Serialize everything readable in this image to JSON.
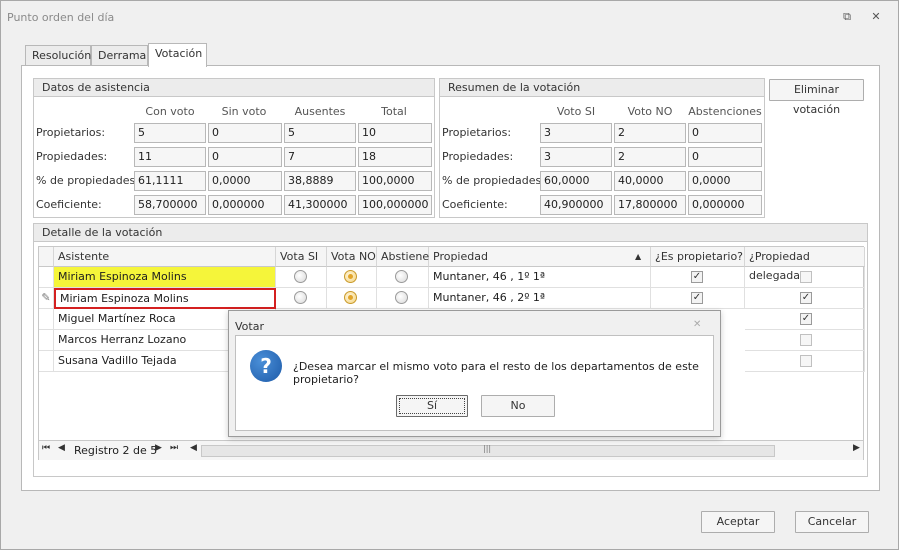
{
  "window": {
    "title": "Punto orden del día"
  },
  "tabs": [
    {
      "label": "Resolución"
    },
    {
      "label": "Derrama"
    },
    {
      "label": "Votación"
    }
  ],
  "asistencia": {
    "title": "Datos de asistencia",
    "columns": [
      "Con voto",
      "Sin voto",
      "Ausentes",
      "Total"
    ],
    "rows": [
      {
        "label": "Propietarios:",
        "values": [
          "5",
          "0",
          "5",
          "10"
        ]
      },
      {
        "label": "Propiedades:",
        "values": [
          "11",
          "0",
          "7",
          "18"
        ]
      },
      {
        "label": "% de propiedades:",
        "values": [
          "61,1111",
          "0,0000",
          "38,8889",
          "100,0000"
        ]
      },
      {
        "label": "Coeficiente:",
        "values": [
          "58,700000",
          "0,000000",
          "41,300000",
          "100,000000"
        ]
      }
    ]
  },
  "resumen": {
    "title": "Resumen de la votación",
    "columns": [
      "Voto SI",
      "Voto NO",
      "Abstenciones"
    ],
    "rows": [
      {
        "label": "Propietarios:",
        "values": [
          "3",
          "2",
          "0"
        ]
      },
      {
        "label": "Propiedades:",
        "values": [
          "3",
          "2",
          "0"
        ]
      },
      {
        "label": "% de propiedades:",
        "values": [
          "60,0000",
          "40,0000",
          "0,0000"
        ]
      },
      {
        "label": "Coeficiente:",
        "values": [
          "40,900000",
          "17,800000",
          "0,000000"
        ]
      }
    ]
  },
  "eliminar_label": "Eliminar votación",
  "detalle": {
    "title": "Detalle de la votación",
    "headers": [
      "Asistente",
      "Vota SI",
      "Vota NO",
      "Abstiene",
      "Propiedad",
      "¿Es propietario?",
      "¿Propiedad delegada?"
    ],
    "rows": [
      {
        "asistente": "Miriam Espinoza Molins",
        "propiedad": "Muntaner, 46 , 1º 1ª"
      },
      {
        "asistente": "Miriam Espinoza Molins",
        "propiedad": "Muntaner, 46 , 2º 1ª"
      },
      {
        "asistente": "Miguel Martínez Roca",
        "propiedad": ""
      },
      {
        "asistente": "Marcos Herranz Lozano",
        "propiedad": ""
      },
      {
        "asistente": "Susana Vadillo Tejada",
        "propiedad": ""
      }
    ],
    "navigator": "Registro 2 de 5"
  },
  "dialog": {
    "title": "Votar",
    "message": "¿Desea marcar el mismo voto para el resto de los departamentos de este propietario?",
    "yes_label": "Sí",
    "no_label": "No"
  },
  "footer": {
    "accept_label": "Aceptar",
    "cancel_label": "Cancelar"
  },
  "colors": {
    "highlight": "#f5f53a",
    "focus": "#d42020",
    "accent": "#1d5aa8"
  }
}
